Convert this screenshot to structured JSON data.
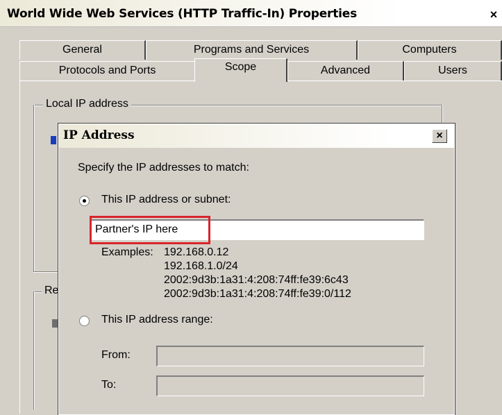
{
  "window": {
    "title": "World Wide Web Services (HTTP Traffic-In) Properties",
    "close_label": "×"
  },
  "tabs": {
    "row1": [
      {
        "label": "General"
      },
      {
        "label": "Programs and Services"
      },
      {
        "label": "Computers"
      }
    ],
    "row2": [
      {
        "label": "Protocols and Ports"
      },
      {
        "label": "Scope",
        "active": true
      },
      {
        "label": "Advanced"
      },
      {
        "label": "Users"
      }
    ]
  },
  "scope_panel": {
    "local_group_label": "Local IP address",
    "remote_group_label": "Re"
  },
  "dialog": {
    "title": "IP Address",
    "close_label": "×",
    "instruction": "Specify the IP addresses to match:",
    "option_subnet": {
      "label": "This IP address or subnet:",
      "selected": true,
      "value": "Partner's IP here"
    },
    "examples": {
      "label": "Examples:",
      "lines": [
        "192.168.0.12",
        "192.168.1.0/24",
        "2002:9d3b:1a31:4:208:74ff:fe39:6c43",
        "2002:9d3b:1a31:4:208:74ff:fe39:0/112"
      ]
    },
    "option_range": {
      "label": "This IP address range:",
      "selected": false,
      "from_label": "From:",
      "to_label": "To:",
      "from_value": "",
      "to_value": ""
    },
    "highlight_color": "#d9242b"
  }
}
